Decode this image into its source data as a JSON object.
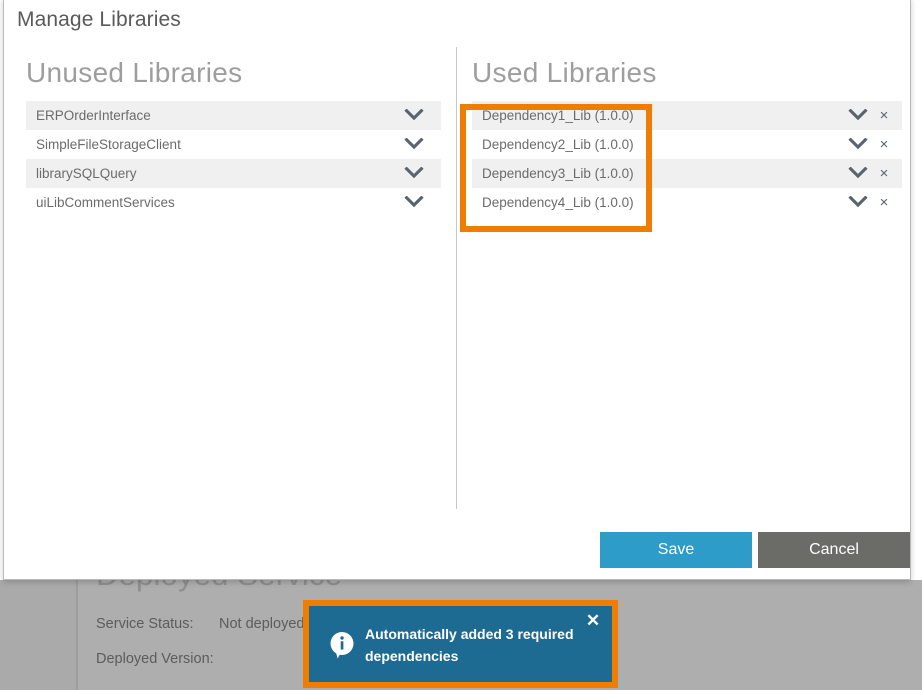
{
  "dialog": {
    "title": "Manage Libraries",
    "unused_panel": {
      "heading": "Unused Libraries",
      "items": [
        {
          "name": "ERPOrderInterface",
          "expand_icon": "chevron-down-icon"
        },
        {
          "name": "SimpleFileStorageClient",
          "expand_icon": "chevron-down-icon"
        },
        {
          "name": "librarySQLQuery",
          "expand_icon": "chevron-down-icon"
        },
        {
          "name": "uiLibCommentServices",
          "expand_icon": "chevron-down-icon"
        }
      ]
    },
    "used_panel": {
      "heading": "Used Libraries",
      "items": [
        {
          "name": "Dependency1_Lib (1.0.0)",
          "expand_icon": "chevron-down-icon",
          "remove_icon": "close-icon",
          "remove_label": "×"
        },
        {
          "name": "Dependency2_Lib (1.0.0)",
          "expand_icon": "chevron-down-icon",
          "remove_icon": "close-icon",
          "remove_label": "×"
        },
        {
          "name": "Dependency3_Lib (1.0.0)",
          "expand_icon": "chevron-down-icon",
          "remove_icon": "close-icon",
          "remove_label": "×"
        },
        {
          "name": "Dependency4_Lib (1.0.0)",
          "expand_icon": "chevron-down-icon",
          "remove_icon": "close-icon",
          "remove_label": "×"
        }
      ]
    },
    "footer": {
      "save_label": "Save",
      "cancel_label": "Cancel"
    }
  },
  "toast": {
    "icon": "info-bubble-icon",
    "message": "Automatically added 3 required dependencies",
    "close_label": "✕"
  },
  "background": {
    "heading": "Deployed Service",
    "service_status_label": "Service Status:",
    "service_status_value": "Not deployed",
    "deployed_version_label": "Deployed Version:",
    "deployed_version_value": ""
  },
  "colors": {
    "accent_blue": "#2e9cc9",
    "cancel_gray": "#6b6b68",
    "annotation_orange": "#ef7d00",
    "toast_teal": "#1d6a92",
    "row_alt": "#f0f0f0"
  }
}
